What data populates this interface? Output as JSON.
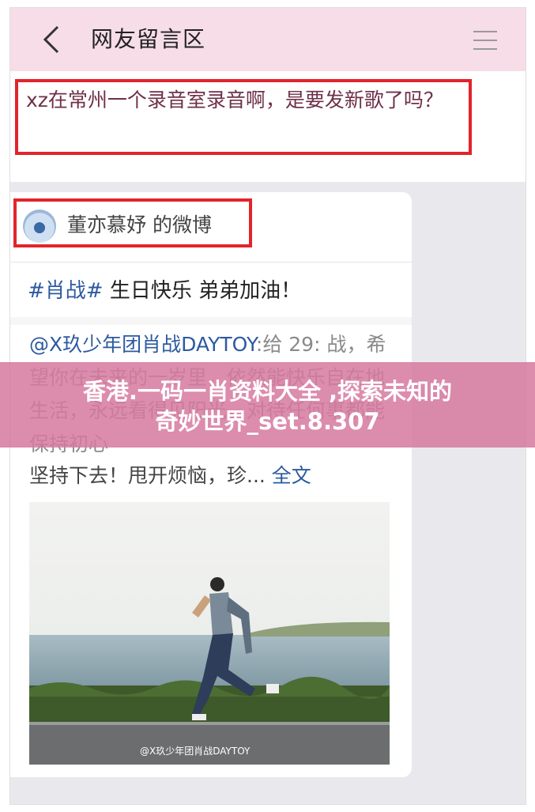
{
  "nav": {
    "title": "网友留言区",
    "back_icon": "chevron-left-icon",
    "menu_icon": "hamburger-menu-icon"
  },
  "message": {
    "text": "xz在常州一个录音室录音啊，是要发新歌了吗？"
  },
  "card": {
    "author": "董亦慕妤 的微博",
    "hashtag": "#肖战#",
    "tag_text": " 生日快乐 弟弟加油！",
    "mention": "@X玖少年团肖战DAYTOY",
    "repost_body": ":给 29: 战，希望你在未来的一岁里，依然能快乐自在地生活，永远看得见阳光。对待任何事都能保持初心",
    "repost_last": "坚持下去！甩开烦恼，珍...",
    "full_link": "全文",
    "photo_watermark": "@X玖少年团肖战DAYTOY"
  },
  "banner": {
    "line1": "香港.一码一肖资料大全 ,探索未知的",
    "line2": "奇妙世界_set.8.307"
  },
  "colors": {
    "nav_bg": "#f6dde7",
    "highlight_border": "#e2242b",
    "link_blue": "#2c5aa0",
    "banner_bg": "#d6789e"
  }
}
